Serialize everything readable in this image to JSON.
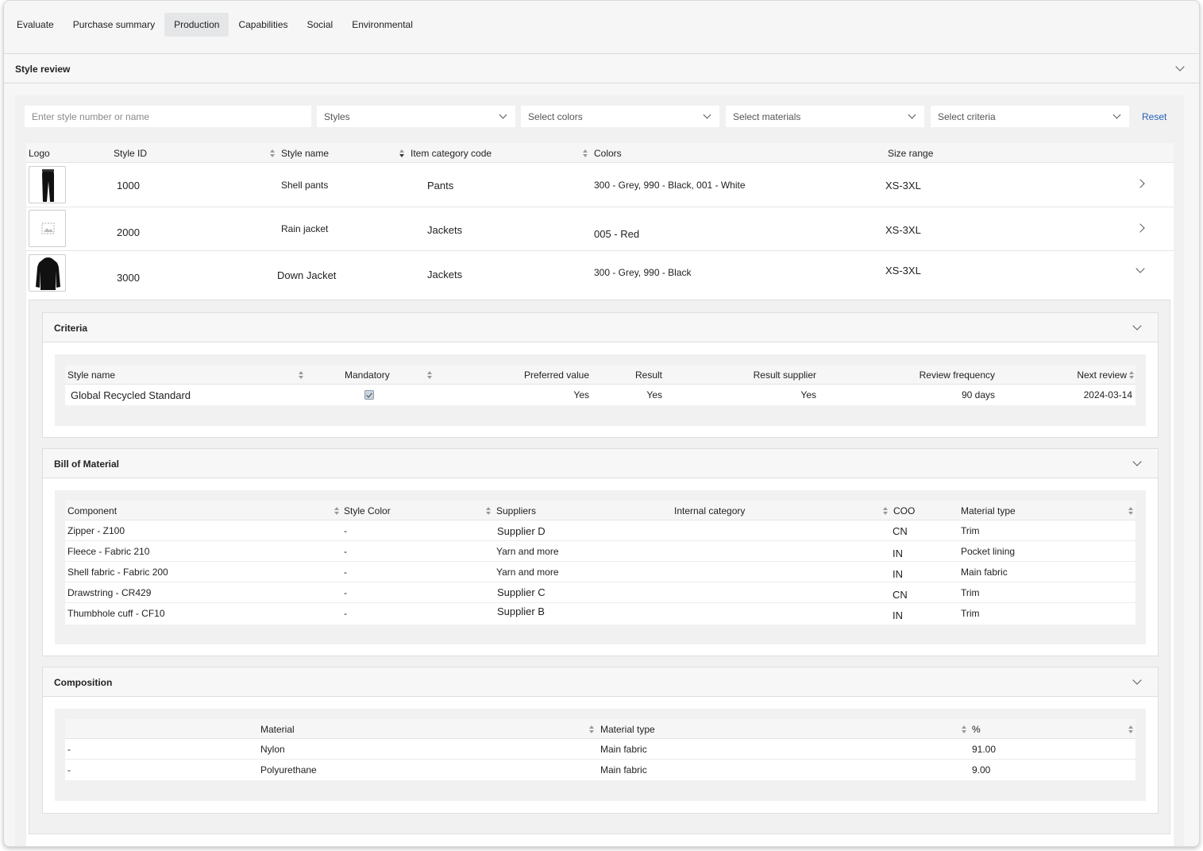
{
  "tabs": [
    "Evaluate",
    "Purchase summary",
    "Production",
    "Capabilities",
    "Social",
    "Environmental"
  ],
  "active_tab": "Production",
  "section": {
    "title": "Style review"
  },
  "filters": {
    "search_placeholder": "Enter style number or name",
    "styles": "Styles",
    "colors": "Select colors",
    "materials": "Select materials",
    "criteria": "Select criteria",
    "reset": "Reset"
  },
  "styles_table": {
    "headers": [
      "Logo",
      "Style ID",
      "Style name",
      "Item category code",
      "Colors",
      "Size range"
    ],
    "rows": [
      {
        "id": "1000",
        "name": "Shell pants",
        "category": "Pants",
        "colors": "300 - Grey, 990 - Black, 001 - White",
        "size": "XS-3XL",
        "logo": "pants-image"
      },
      {
        "id": "2000",
        "name": "Rain jacket",
        "category": "Jackets",
        "colors": "005 - Red",
        "size": "XS-3XL",
        "logo": "image-placeholder-icon"
      },
      {
        "id": "3000",
        "name": "Down Jacket",
        "category": "Jackets",
        "colors": "300 - Grey, 990 - Black",
        "size": "XS-3XL",
        "logo": "down-jacket-image"
      }
    ]
  },
  "criteria": {
    "title": "Criteria",
    "headers": [
      "Style name",
      "Mandatory",
      "Preferred value",
      "Result",
      "Result supplier",
      "Review frequency",
      "Next review"
    ],
    "rows": [
      {
        "style_name": "Global Recycled Standard",
        "mandatory": true,
        "preferred": "Yes",
        "result": "Yes",
        "result_supplier": "Yes",
        "frequency": "90 days",
        "next_review": "2024-03-14"
      }
    ]
  },
  "bom": {
    "title": "Bill of Material",
    "headers": [
      "Component",
      "Style Color",
      "Suppliers",
      "Internal category",
      "COO",
      "Material type"
    ],
    "rows": [
      {
        "component": "Zipper - Z100",
        "color": "-",
        "supplier": "Supplier D",
        "internal": "",
        "coo": "CN",
        "type": "Trim"
      },
      {
        "component": "Fleece - Fabric 210",
        "color": "-",
        "supplier": "Yarn and more",
        "internal": "",
        "coo": "IN",
        "type": "Pocket lining"
      },
      {
        "component": "Shell fabric - Fabric 200",
        "color": "-",
        "supplier": "Yarn and more",
        "internal": "",
        "coo": "IN",
        "type": "Main fabric"
      },
      {
        "component": "Drawstring - CR429",
        "color": "-",
        "supplier": "Supplier C",
        "internal": "",
        "coo": "CN",
        "type": "Trim"
      },
      {
        "component": "Thumbhole cuff - CF10",
        "color": "-",
        "supplier": "Supplier B",
        "internal": "",
        "coo": "IN",
        "type": "Trim"
      }
    ]
  },
  "composition": {
    "title": "Composition",
    "headers": [
      "",
      "Material",
      "Material type",
      "%"
    ],
    "rows": [
      {
        "dash": "-",
        "material": "Nylon",
        "type": "Main fabric",
        "pct": "91.00"
      },
      {
        "dash": "-",
        "material": "Polyurethane",
        "type": "Main fabric",
        "pct": "9.00"
      }
    ]
  }
}
